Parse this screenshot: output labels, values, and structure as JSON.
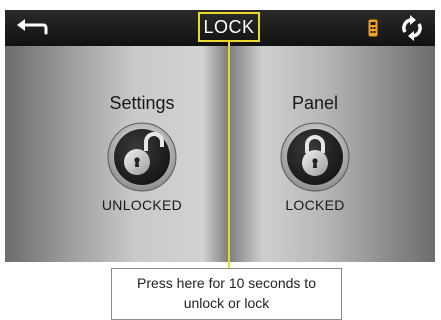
{
  "header": {
    "title": "LOCK",
    "back_icon": "back-arrow-icon",
    "remote_icon": "remote-icon",
    "refresh_icon": "refresh-icon",
    "accent_color": "#e8d92a"
  },
  "locks": [
    {
      "label": "Settings",
      "state": "UNLOCKED",
      "icon": "unlocked-padlock-icon"
    },
    {
      "label": "Panel",
      "state": "LOCKED",
      "icon": "locked-padlock-icon"
    }
  ],
  "callout": {
    "line1": "Press here for 10 seconds to",
    "line2": "unlock or lock"
  }
}
